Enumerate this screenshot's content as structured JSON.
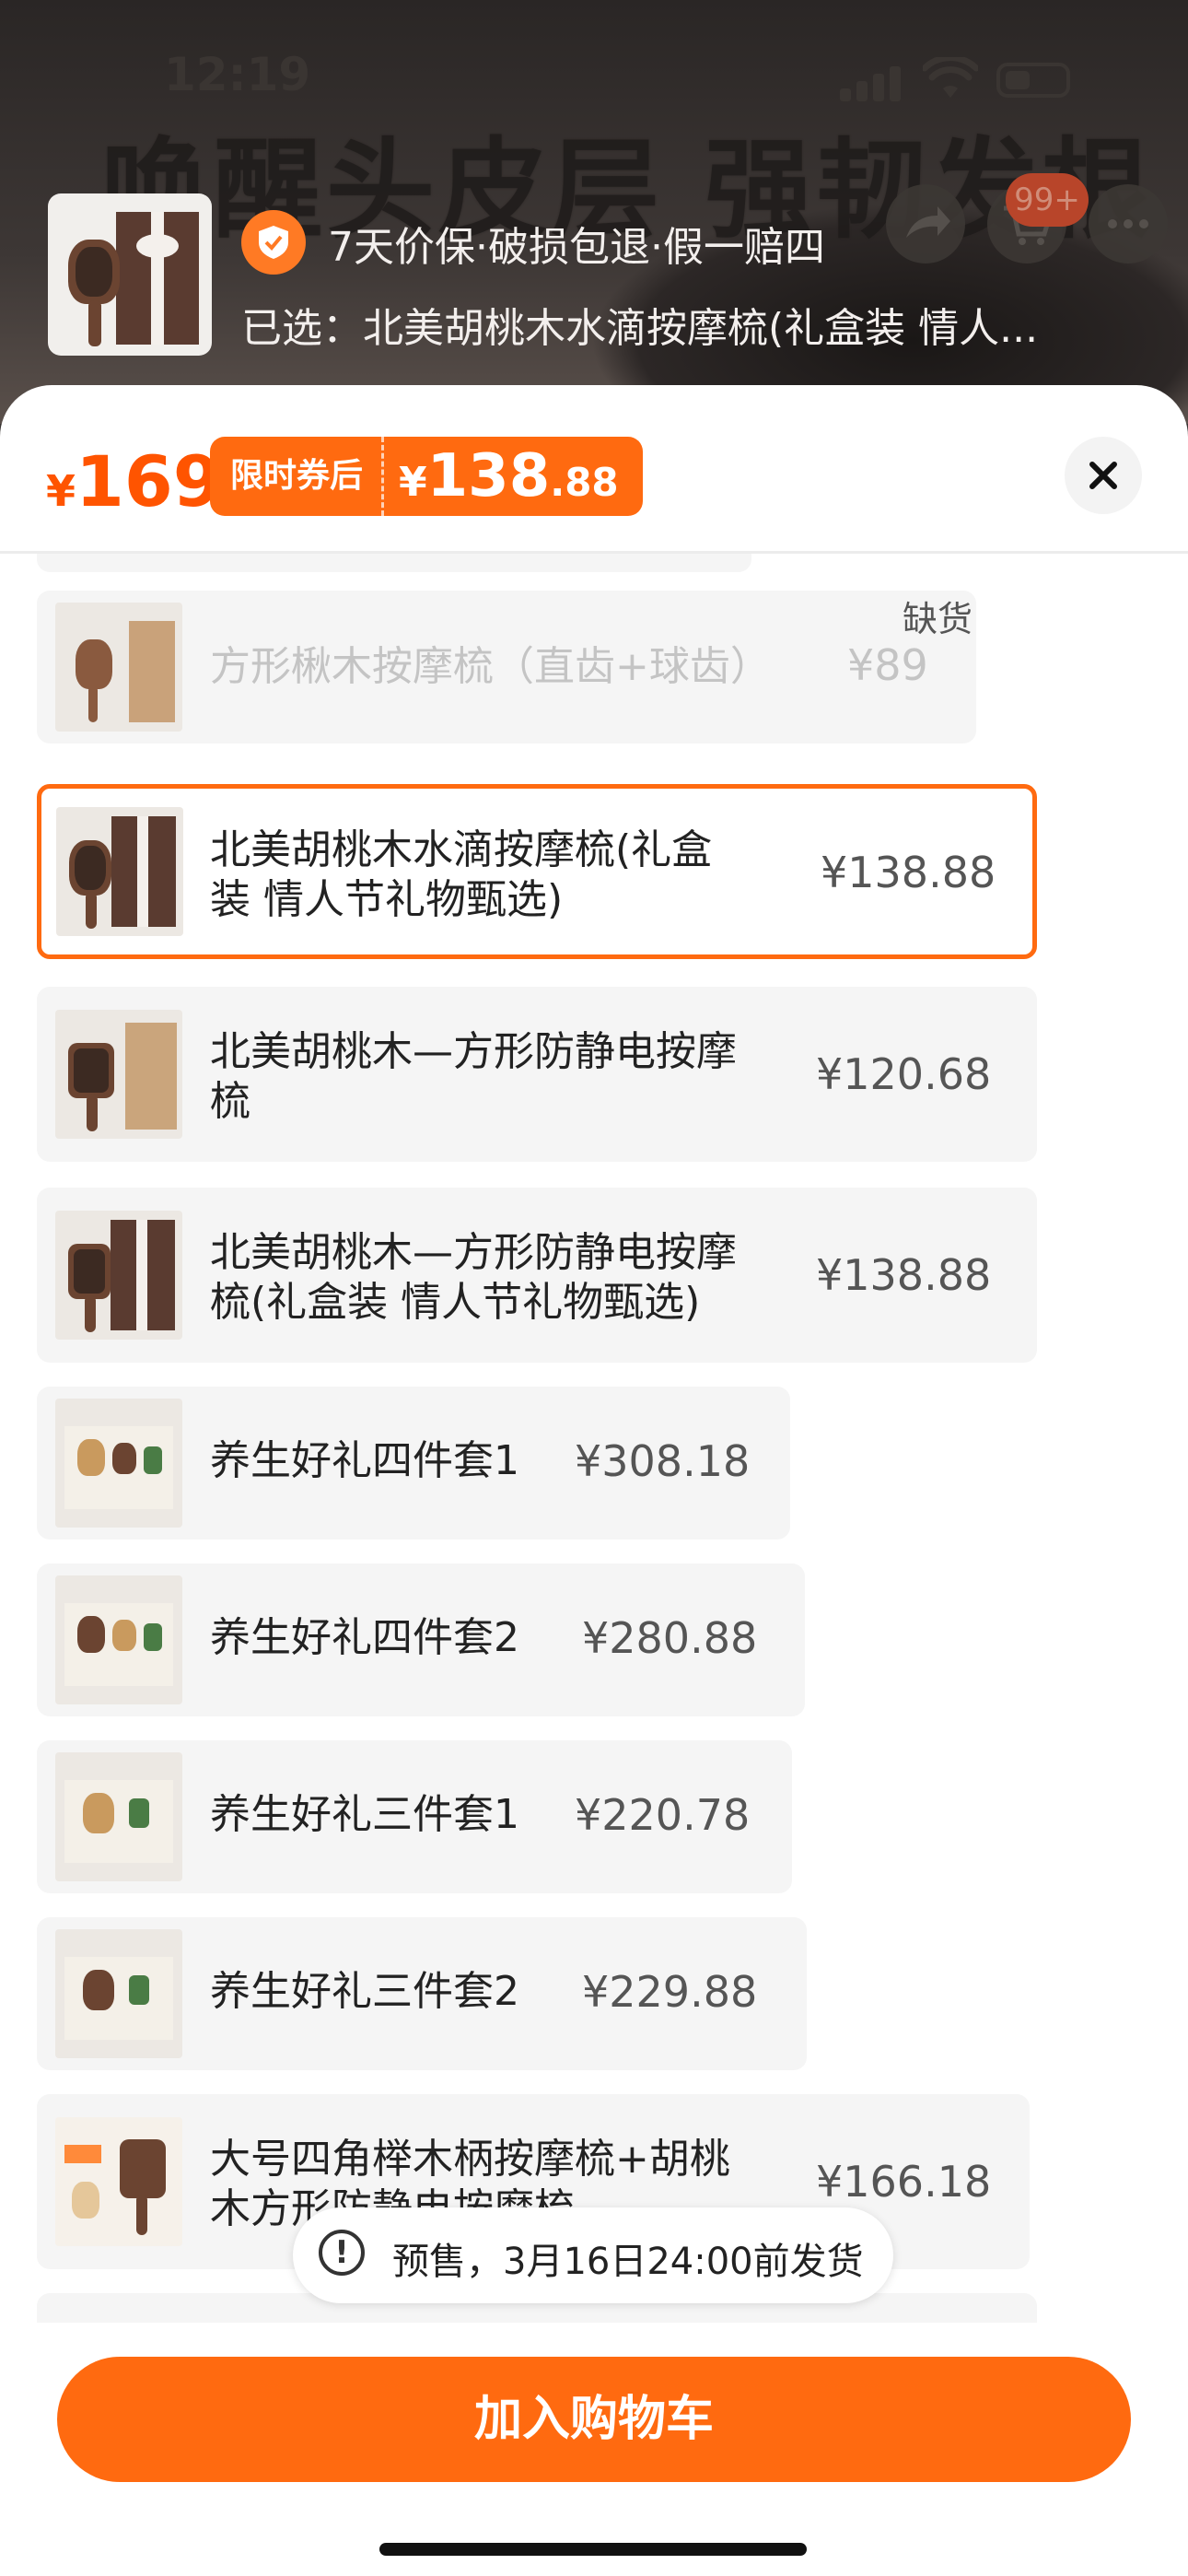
{
  "status_bar": {
    "time": "12:19"
  },
  "background": {
    "banner_text": "唤醒头皮层 强韧发根",
    "cart_count": "99+"
  },
  "header": {
    "guarantee": "7天价保·破损包退·假一赔四",
    "selected_label": "已选：北美胡桃木水滴按摩梳(礼盒装 情人..."
  },
  "price_bar": {
    "currency": "¥",
    "price": "169",
    "coupon_label": "限时券后",
    "coupon_int": "138",
    "coupon_dec": ".88"
  },
  "options": [
    {
      "name": "方形楸木按摩梳（直齿+球齿）",
      "price": "¥89",
      "status": "缺货",
      "disabled": true
    },
    {
      "name": "北美胡桃木水滴按摩梳(礼盒装 情人节礼物甄选)",
      "name_l1": "北美胡桃木水滴按摩梳(礼盒",
      "name_l2": "装 情人节礼物甄选)",
      "price": "¥138.88",
      "selected": true
    },
    {
      "name_l1": "北美胡桃木—方形防静电按摩",
      "name_l2": "梳",
      "price": "¥120.68"
    },
    {
      "name_l1": "北美胡桃木—方形防静电按摩",
      "name_l2": "梳(礼盒装 情人节礼物甄选)",
      "price": "¥138.88"
    },
    {
      "name": "养生好礼四件套1",
      "price": "¥308.18"
    },
    {
      "name": "养生好礼四件套2",
      "price": "¥280.88"
    },
    {
      "name": "养生好礼三件套1",
      "price": "¥220.78"
    },
    {
      "name": "养生好礼三件套2",
      "price": "¥229.88"
    },
    {
      "name_l1": "大号四角榉木柄按摩梳+胡桃",
      "name_l2": "木方形防静电按摩梳",
      "price": "¥166.18"
    }
  ],
  "presale": {
    "icon": "!",
    "text": "预售，3月16日24:00前发货"
  },
  "add_to_cart": "加入购物车",
  "colors": {
    "accent": "#ff6a10",
    "price": "#ff5400"
  }
}
